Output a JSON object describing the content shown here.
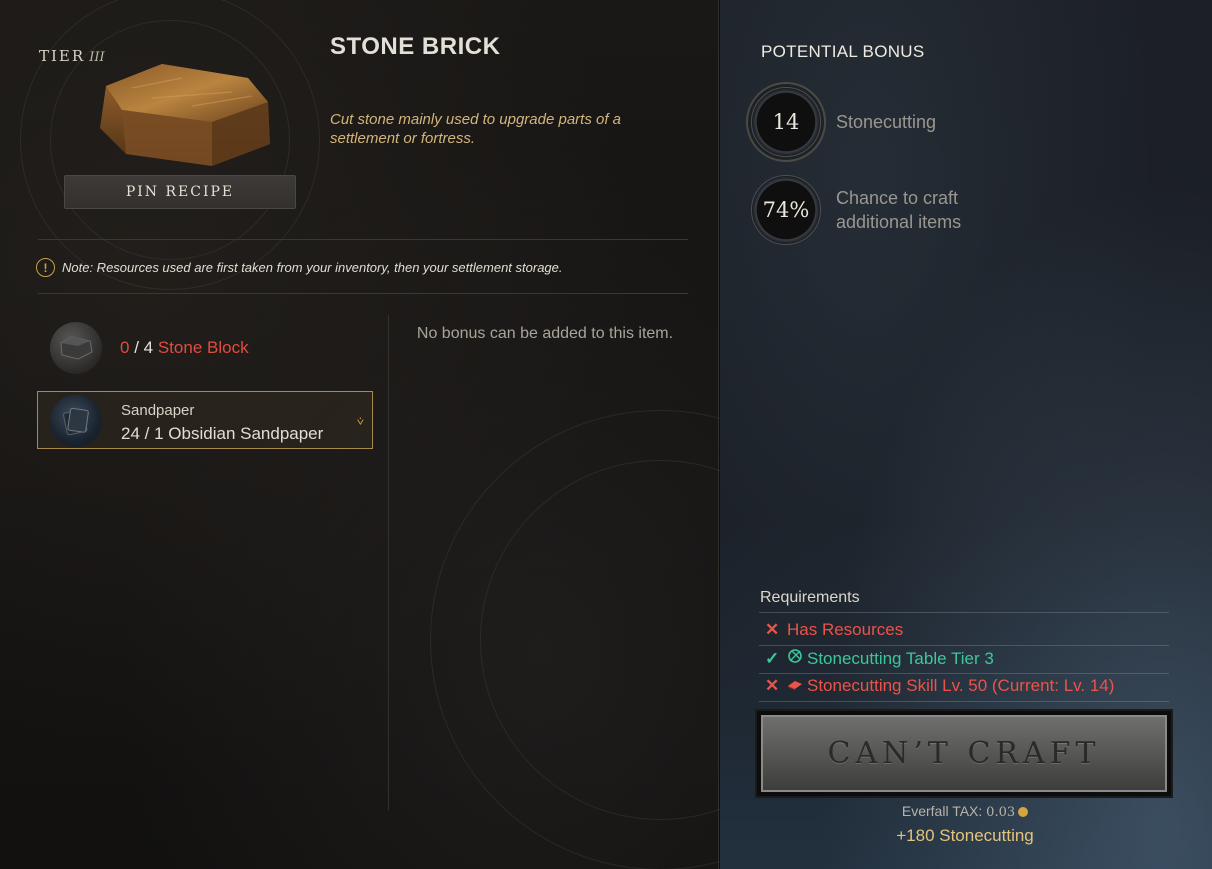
{
  "recipe": {
    "tier_label": "TIER",
    "tier_roman": "III",
    "title": "STONE BRICK",
    "description": "Cut stone mainly used to upgrade parts of a settlement or fortress.",
    "pin_label": "PIN RECIPE"
  },
  "note": {
    "icon": "exclamation-icon",
    "text": "Note: Resources used are first taken from your inventory, then your settlement storage."
  },
  "resources": [
    {
      "icon": "stone-block-icon",
      "have": "0",
      "separator": " / ",
      "need": "4",
      "name": "Stone Block",
      "status_color": "#e04c40"
    },
    {
      "icon": "obsidian-sandpaper-icon",
      "category": "Sandpaper",
      "have": "24",
      "separator": " / ",
      "need": "1",
      "name": "Obsidian Sandpaper",
      "expand_icon": "chevron-down-icon"
    }
  ],
  "bonus_area": {
    "message": "No bonus can be added to this item."
  },
  "potential_bonus": {
    "title": "POTENTIAL BONUS",
    "skill_level": "14",
    "skill_name": "Stonecutting",
    "chance_value": "74%",
    "chance_line1": "Chance to craft",
    "chance_line2": "additional items"
  },
  "requirements": {
    "title": "Requirements",
    "items": [
      {
        "status": "fail",
        "mark": "✕",
        "icon": "",
        "text": "Has Resources"
      },
      {
        "status": "ok",
        "mark": "✓",
        "icon": "stonecutting-table-icon",
        "text": "Stonecutting Table Tier 3"
      },
      {
        "status": "fail",
        "mark": "✕",
        "icon": "skill-icon",
        "text": "Stonecutting Skill Lv. 50 (Current: Lv. 14)"
      }
    ]
  },
  "craft": {
    "button_label": "CAN’T CRAFT",
    "tax_label": "Everfall TAX: ",
    "tax_value": "0.03",
    "tax_icon": "coin-icon",
    "xp_text": "+180 Stonecutting"
  },
  "colors": {
    "fail": "#ec5349",
    "ok": "#3bc79a",
    "accent_gold": "#c9a24b",
    "description": "#d2b57a"
  }
}
